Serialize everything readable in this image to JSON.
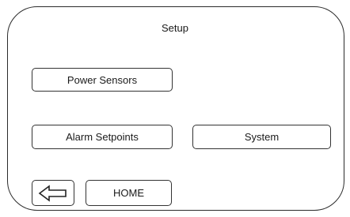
{
  "screen": {
    "title": "Setup"
  },
  "buttons": {
    "power_sensors": "Power Sensors",
    "alarm_setpoints": "Alarm Setpoints",
    "system": "System",
    "home": "HOME"
  },
  "icons": {
    "back": "back-arrow-icon"
  }
}
